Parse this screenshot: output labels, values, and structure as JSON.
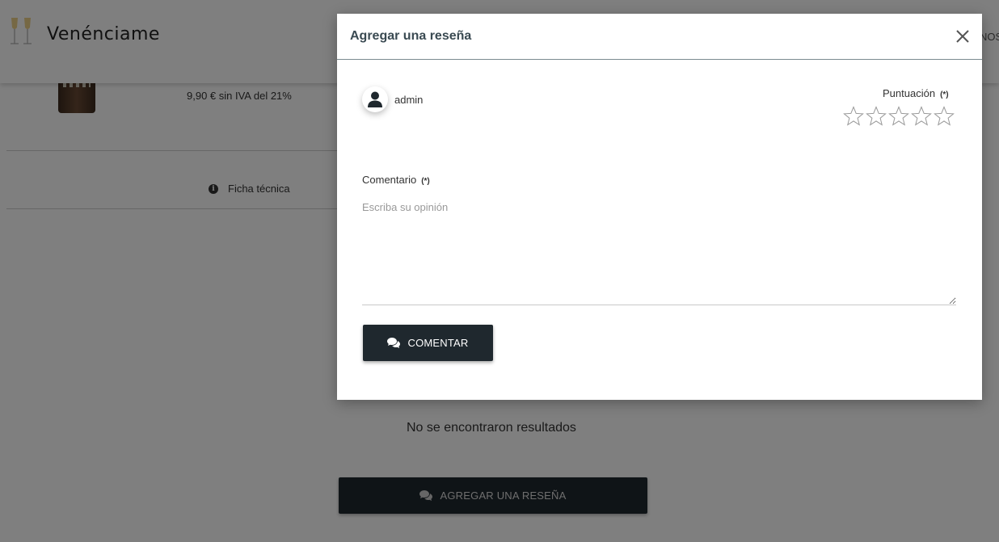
{
  "header": {
    "logo_text": "Venénciame",
    "nav_partial": "NOS"
  },
  "product": {
    "price_text": "9,90 € sin IVA del 21%"
  },
  "tabs": {
    "ficha_label": "Ficha técnica"
  },
  "reviews": {
    "empty_text": "No se encontraron resultados",
    "add_button_label": "AGREGAR UNA RESEÑA"
  },
  "modal": {
    "title": "Agregar una reseña",
    "user": {
      "name": "admin"
    },
    "rating": {
      "label": "Puntuación",
      "required_marker": "(*)",
      "max_stars": 5,
      "value": 0
    },
    "comment": {
      "label": "Comentario",
      "required_marker": "(*)",
      "placeholder": "Escriba su opinión",
      "value": ""
    },
    "submit_label": "COMENTAR"
  },
  "colors": {
    "button_bg": "#1f282e",
    "title_color": "#3a4a52",
    "overlay": "rgba(0,0,0,0.5)"
  }
}
